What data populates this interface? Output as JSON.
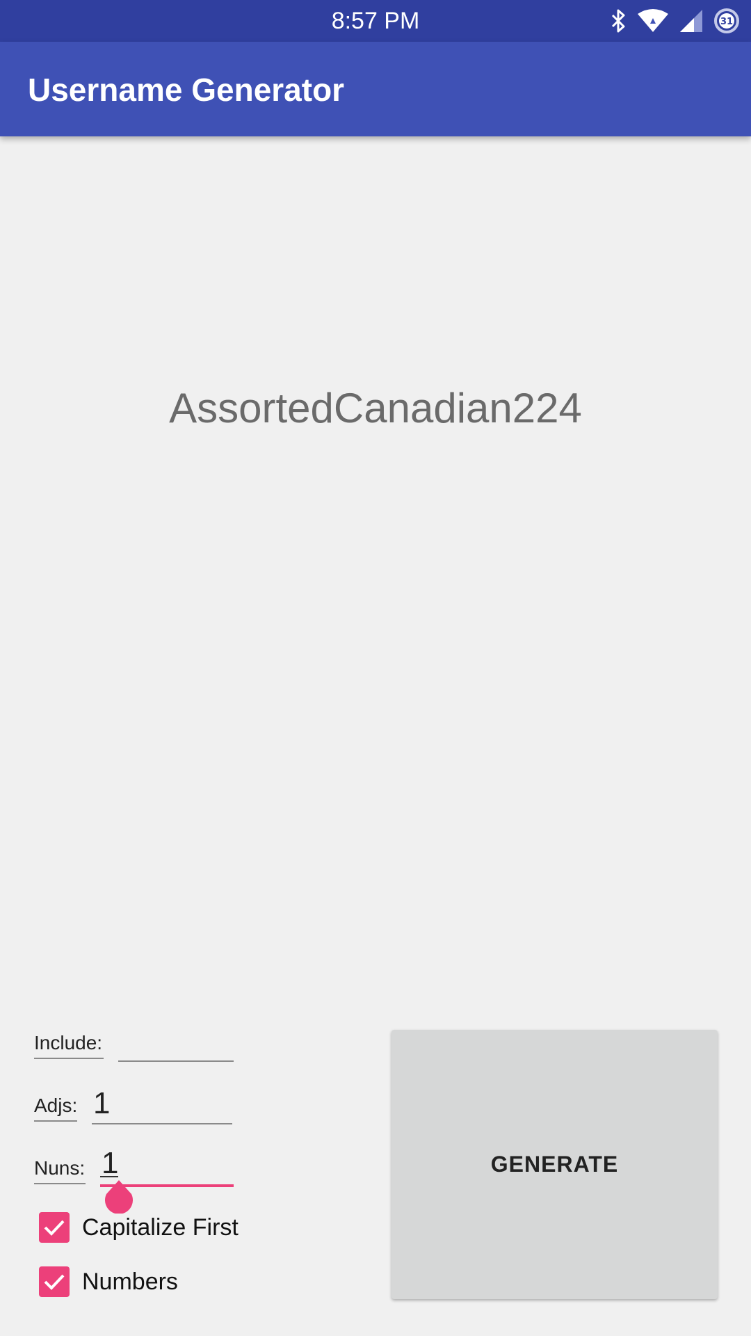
{
  "status_bar": {
    "time": "8:57 PM",
    "icons": [
      "bluetooth-icon",
      "wifi-icon",
      "cell-signal-icon",
      "calendar-badge-icon"
    ],
    "badge_number": "31"
  },
  "app_bar": {
    "title": "Username Generator"
  },
  "result": {
    "username": "AssortedCanadian224"
  },
  "form": {
    "include": {
      "label": "Include:",
      "value": ""
    },
    "adjs": {
      "label": "Adjs:",
      "value": "1"
    },
    "nuns": {
      "label": "Nuns:",
      "value": "1"
    }
  },
  "options": {
    "capitalize_first": {
      "label": "Capitalize First",
      "checked": true
    },
    "numbers": {
      "label": "Numbers",
      "checked": true
    }
  },
  "actions": {
    "generate_label": "GENERATE"
  },
  "colors": {
    "status_bar": "#303f9f",
    "app_bar": "#3f51b5",
    "accent": "#ec407a",
    "background": "#f0f0f0",
    "button": "#d6d7d7"
  }
}
